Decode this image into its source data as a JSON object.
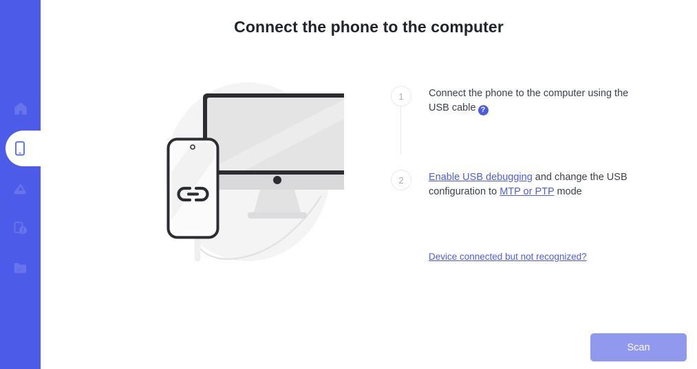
{
  "sidebar": {
    "background_color": "#4C5CE8",
    "items": [
      {
        "id": "home",
        "icon": "home-icon",
        "label": "Home",
        "active": false
      },
      {
        "id": "phone",
        "icon": "phone-icon",
        "label": "Phone Transfer",
        "active": true
      },
      {
        "id": "backup",
        "icon": "cloud-backup-icon",
        "label": "Backup",
        "active": false
      },
      {
        "id": "repair",
        "icon": "device-repair-icon",
        "label": "Repair",
        "active": false
      },
      {
        "id": "files",
        "icon": "folder-icon",
        "label": "Files",
        "active": false
      }
    ]
  },
  "main": {
    "title": "Connect the phone to the computer",
    "illustration": {
      "name": "phone-connected-to-computer-illustration",
      "phone_screen_icon": "chain-link-icon"
    },
    "steps": [
      {
        "number": "1",
        "text_before": "Connect the phone to the computer using the USB cable",
        "help_icon_label": "?"
      },
      {
        "number": "2",
        "link1": "Enable USB debugging",
        "text_middle": " and change the USB configuration to ",
        "link2": "MTP or PTP",
        "text_after": " mode"
      }
    ],
    "not_recognized_link": "Device connected but not recognized?",
    "scan_button": {
      "label": "Scan",
      "enabled": false,
      "color": "#9199EE"
    }
  },
  "colors": {
    "accent": "#4C5CE8",
    "accent_muted": "#9199EE",
    "page_background": "#ffffff",
    "title_text": "#21242b",
    "body_text": "#3c4049",
    "step_marker_border": "#e9eaee"
  }
}
